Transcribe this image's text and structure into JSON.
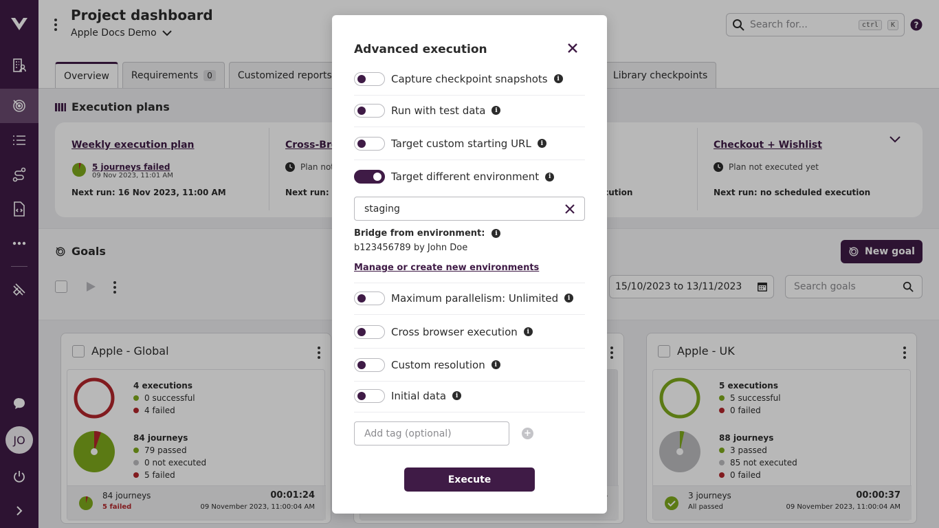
{
  "colors": {
    "brand": "#3f1b46",
    "success": "#7fa91c",
    "failure": "#b3262b",
    "muted": "#bdbdc0"
  },
  "header": {
    "title": "Project dashboard",
    "project": "Apple Docs Demo",
    "search_placeholder": "Search for...",
    "kbd_ctrl": "ctrl",
    "kbd_k": "K"
  },
  "tabs": [
    {
      "label": "Overview"
    },
    {
      "label": "Requirements",
      "count": "0"
    },
    {
      "label": "Customized reports"
    },
    {
      "label": "Library checkpoints"
    }
  ],
  "plans": {
    "title": "Execution plans",
    "items": [
      {
        "name": "Weekly execution plan",
        "status": "5 journeys failed",
        "date": "09 Nov 2023, 11:01 AM",
        "next": "Next run: 16 Nov 2023, 11:00 AM"
      },
      {
        "name": "Cross-Bro",
        "status": "Plan not",
        "next": "Next run: no"
      },
      {
        "name_tail": "",
        "next_tail": "ecution"
      },
      {
        "name": "Checkout + Wishlist",
        "status": "Plan not executed yet",
        "next": "Next run: no scheduled execution"
      }
    ]
  },
  "goals": {
    "title": "Goals",
    "new_goal": "New goal",
    "date_range": "15/10/2023 to 13/11/2023",
    "search_placeholder": "Search goals",
    "cards": [
      {
        "name": "Apple - Global",
        "executions": "4 executions",
        "successful": "0 successful",
        "failed": "4 failed",
        "journeys": "84 journeys",
        "passed": "79 passed",
        "not_executed": "0 not executed",
        "j_failed": "5 failed",
        "foot_journeys": "84 journeys",
        "foot_status": "5 failed",
        "duration": "00:01:24",
        "timestamp": "09 November 2023, 11:00:04 AM"
      },
      {
        "duration_tail": "4"
      },
      {
        "name": "Apple - UK",
        "executions": "5 executions",
        "successful": "5 successful",
        "failed": "0 failed",
        "journeys": "88 journeys",
        "passed": "3 passed",
        "not_executed": "85 not executed",
        "j_failed": "0 failed",
        "foot_journeys": "3 journeys",
        "foot_status": "All passed",
        "duration": "00:00:37",
        "timestamp": "09 November 2023, 11:00:04 AM"
      }
    ]
  },
  "sidebar": {
    "avatar": "JO"
  },
  "modal": {
    "title": "Advanced execution",
    "options": [
      {
        "label": "Capture checkpoint snapshots",
        "on": false
      },
      {
        "label": "Run with test data",
        "on": false
      },
      {
        "label": "Target custom starting URL",
        "on": false
      },
      {
        "label": "Target different environment",
        "on": true
      },
      {
        "label": "Maximum parallelism: Unlimited",
        "on": false
      },
      {
        "label": "Cross browser execution",
        "on": false
      },
      {
        "label": "Custom resolution",
        "on": false
      },
      {
        "label": "Initial data",
        "on": false
      }
    ],
    "environment_value": "staging",
    "bridge_label": "Bridge from environment:",
    "bridge_value": "b123456789 by John Doe",
    "manage_link": "Manage or create new environments",
    "tag_placeholder": "Add tag (optional)",
    "execute_label": "Execute"
  }
}
